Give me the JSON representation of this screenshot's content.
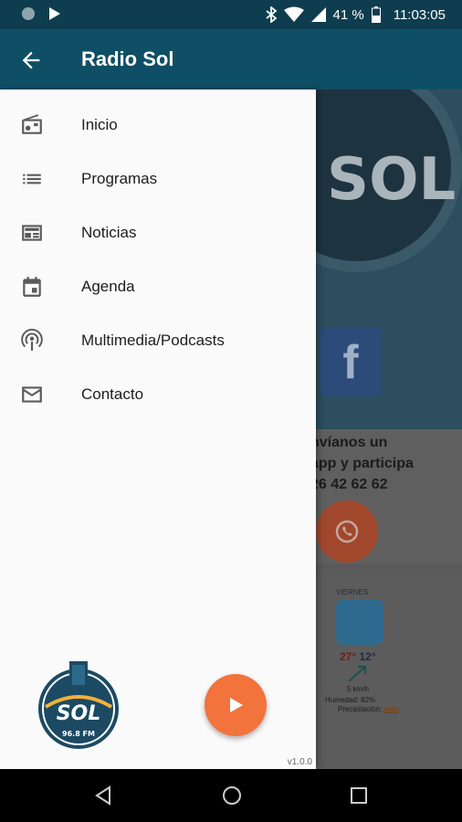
{
  "status_bar": {
    "battery": "41 %",
    "time": "11:03:05",
    "icons": [
      "notification-dot-icon",
      "play-icon",
      "bluetooth-icon",
      "wifi-icon",
      "signal-icon",
      "battery-icon"
    ]
  },
  "app_bar": {
    "title": "Radio Sol",
    "back_icon": "arrow-back-icon"
  },
  "drawer": {
    "items": [
      {
        "label": "Inicio",
        "icon": "radio-icon"
      },
      {
        "label": "Programas",
        "icon": "list-icon"
      },
      {
        "label": "Noticias",
        "icon": "newspaper-icon"
      },
      {
        "label": "Agenda",
        "icon": "calendar-icon"
      },
      {
        "label": "Multimedia/Podcasts",
        "icon": "podcast-icon"
      },
      {
        "label": "Contacto",
        "icon": "mail-icon"
      }
    ],
    "version": "v1.0.0",
    "logo_alt": "Radio SOL 96.8 FM"
  },
  "background": {
    "contact_lines": [
      "nvíanos un",
      "app y participa",
      "26 42 62 62"
    ],
    "weather": {
      "day": "VIERNES",
      "high": "27°",
      "low": "12°",
      "wind": "5 km/h",
      "humidity": "Humedad: 82%",
      "precip_label": "Precipitación:",
      "precip_value": "alida"
    }
  },
  "colors": {
    "app_bar": "#0f4f66",
    "status_bar": "#0e3d4f",
    "accent": "#f2733c",
    "drawer_bg": "#fafafa"
  }
}
